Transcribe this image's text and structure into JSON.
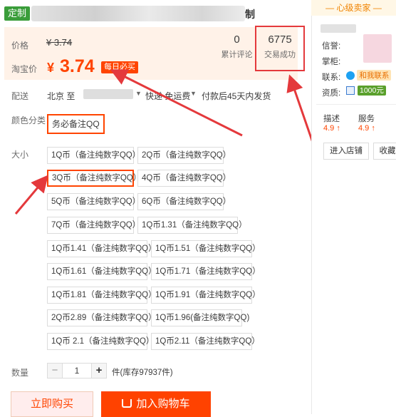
{
  "header": {
    "custom_tag": "定制",
    "title_tail": "制"
  },
  "price": {
    "label_price": "价格",
    "original": "¥ 3.74",
    "label_taobao": "淘宝价",
    "currency": "¥",
    "current": "3.74",
    "badge": "每日必买",
    "reviews_count": "0",
    "reviews_label": "累计评论",
    "sales_count": "6775",
    "sales_label": "交易成功"
  },
  "delivery": {
    "label": "配送",
    "from": "北京 至",
    "method": "快递 免运费",
    "note": "付款后45天内发货"
  },
  "color": {
    "label": "颜色分类",
    "option": "务必备注QQ"
  },
  "size": {
    "label": "大小",
    "options": [
      "1Q币（备注纯数字QQ）",
      "2Q币（备注纯数字QQ）",
      "3Q币（备注纯数字QQ）",
      "4Q币（备注纯数字QQ）",
      "5Q币（备注纯数字QQ）",
      "6Q币（备注纯数字QQ）",
      "7Q币（备注纯数字QQ）",
      "1Q币1.31（备注纯数字QQ）",
      "1Q币1.41（备注纯数字QQ）",
      "1Q币1.51（备注纯数字QQ）",
      "1Q币1.61（备注纯数字QQ）",
      "1Q币1.71（备注纯数字QQ）",
      "1Q币1.81（备注纯数字QQ）",
      "1Q币1.91（备注纯数字QQ）",
      "2Q币2.89（备注纯数字QQ）",
      "1Q币1.96(备注纯数字QQ)",
      "1Q币 2.1（备注纯数字QQ）",
      "1Q币2.11（备注纯数字QQ）"
    ],
    "selected_index": 2
  },
  "quantity": {
    "label": "数量",
    "minus": "−",
    "value": "1",
    "plus": "+",
    "stock": "件(库存97937件)"
  },
  "actions": {
    "buy_now": "立即购买",
    "add_cart": "加入购物车"
  },
  "seller": {
    "heading": "— 心级卖家 —",
    "reputation_label": "信誉:",
    "keeper_label": "掌柜:",
    "contact_label": "联系:",
    "contact_button": "和我联系",
    "qualification_label": "资质:",
    "deposit": "1000元",
    "ratings": [
      {
        "name": "描述",
        "score": "4.9",
        "arrow": "↑"
      },
      {
        "name": "服务",
        "score": "4.9",
        "arrow": "↑"
      }
    ],
    "enter_shop": "进入店铺",
    "favorite_shop": "收藏"
  },
  "colors": {
    "accent": "#ff4400",
    "highlight": "#e4393c",
    "price_bg": "#fff2e8",
    "custom_tag": "#3a9d3a"
  }
}
